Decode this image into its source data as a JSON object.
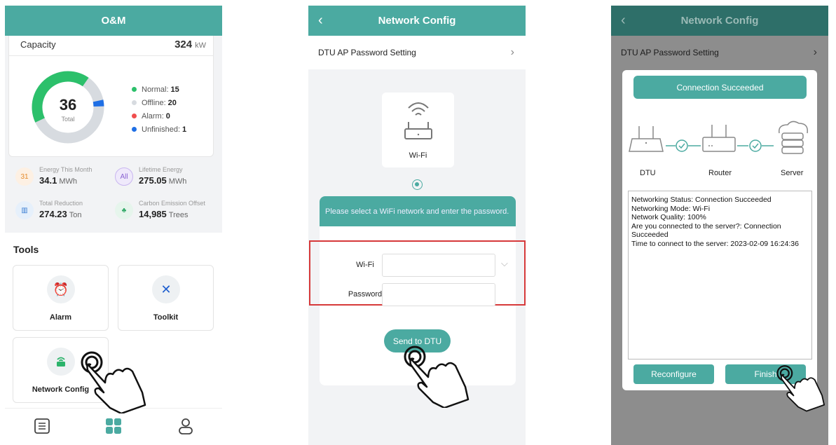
{
  "screen1": {
    "title": "O&M",
    "capacity": {
      "label": "Capacity",
      "value": "324",
      "unit": "kW"
    },
    "donut": {
      "total": "36",
      "total_label": "Total"
    },
    "legend": [
      {
        "label": "Normal:",
        "value": "15",
        "color": "#2cc06b"
      },
      {
        "label": "Offline:",
        "value": "20",
        "color": "#d7dbe0"
      },
      {
        "label": "Alarm:",
        "value": "0",
        "color": "#f04e4e"
      },
      {
        "label": "Unfinished:",
        "value": "1",
        "color": "#1f6fe5"
      }
    ],
    "stats": [
      {
        "label": "Energy This Month",
        "value": "34.1",
        "unit": "MWh",
        "icon": "calendar-icon"
      },
      {
        "label": "Lifetime Energy",
        "value": "275.05",
        "unit": "MWh",
        "icon": "all-icon"
      },
      {
        "label": "Total Reduction",
        "value": "274.23",
        "unit": "Ton",
        "icon": "factory-icon"
      },
      {
        "label": "Carbon Emission Offset",
        "value": "14,985",
        "unit": "Trees",
        "icon": "tree-icon"
      }
    ],
    "tools_title": "Tools",
    "tools": [
      {
        "label": "Alarm",
        "icon": "alarm-icon"
      },
      {
        "label": "Toolkit",
        "icon": "toolkit-icon"
      },
      {
        "label": "Network Config",
        "icon": "router-icon"
      }
    ]
  },
  "screen2": {
    "title": "Network Config",
    "password_setting": "DTU AP Password Setting",
    "wifi_option": "Wi-Fi",
    "tip": "Please select a WiFi network and enter the password.",
    "wifi_label": "Wi-Fi",
    "password_label": "Password",
    "send_button": "Send to DTU"
  },
  "screen3": {
    "title": "Network Config",
    "password_setting": "DTU AP Password Setting",
    "status_banner": "Connection Succeeded",
    "nodes": [
      "DTU",
      "Router",
      "Server"
    ],
    "log_lines": [
      "Networking Status: Connection Succeeded",
      "Networking Mode: Wi-Fi",
      "Network Quality: 100%",
      "Are you connected to the server?: Connection Succeeded",
      "Time to connect to the server: 2023-02-09 16:24:36"
    ],
    "reconfigure_button": "Reconfigure",
    "finish_button": "Finish"
  },
  "colors": {
    "accent": "#4baaa1",
    "highlight": "#d6393a"
  }
}
